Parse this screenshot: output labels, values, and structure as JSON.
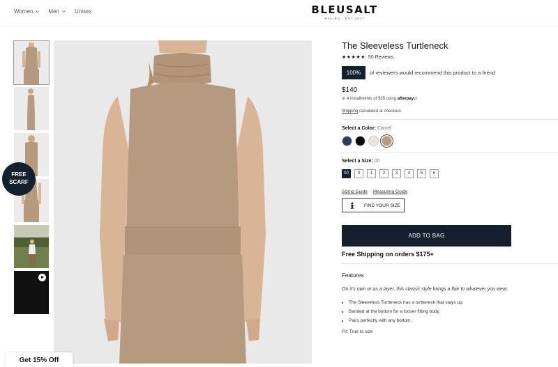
{
  "header": {
    "nav": [
      "Women",
      "Men",
      "Unisex"
    ],
    "brand": "BLEUSALT",
    "brand_sub": "MALIBU · EST 2017"
  },
  "sidebar": {
    "free_scarf_line1": "FREE",
    "free_scarf_line2": "SCARF"
  },
  "promo": {
    "label": "Get 15% Off"
  },
  "product": {
    "title": "The Sleeveless Turtleneck",
    "stars": "★★★★★",
    "rating_value": 5,
    "reviews": "50 Reviews",
    "recommend_badge": "100%",
    "recommend_text": "of reviewers would recommend this product to a friend",
    "price": "$140",
    "afterpay_text": "or 4 installments of $35 using",
    "afterpay_brand": "afterpay",
    "shipping_link": "Shipping",
    "shipping_text": "calculated at checkout.",
    "color_label": "Select a Color:",
    "color_value": "Camel",
    "colors": [
      {
        "name": "navy",
        "hex": "#2e3b60"
      },
      {
        "name": "black",
        "hex": "#0b0b0b"
      },
      {
        "name": "cream",
        "hex": "#ece6da"
      },
      {
        "name": "camel",
        "hex": "#b99a7e"
      }
    ],
    "selected_color": "camel",
    "size_label": "Select a Size:",
    "size_value": "00",
    "sizes": [
      "00",
      "0",
      "1",
      "2",
      "3",
      "4",
      "5",
      "6"
    ],
    "selected_size": "00",
    "sizing_guide": "Sizing Guide",
    "measuring_guide": "Measuring Guide",
    "find_size": "FIND YOUR SIZE",
    "add_to_bag": "ADD TO BAG",
    "free_shipping": "Free Shipping on orders $175+",
    "features_title": "Features",
    "tagline": "On it's own or as a layer, this classic style brings a flair to whatever you wear.",
    "bullets": [
      "The Sleeveless Turtleneck has a turtleneck that stays up.",
      "Banded at the bottom for a looser fitting body.",
      "Pairs perfectly with any bottom."
    ],
    "fit": "Fit: True to size"
  },
  "colors": {
    "accent": "#14202e",
    "garment": "#b69a80",
    "skin": "#d8b597",
    "background": "#e9e9e9"
  }
}
